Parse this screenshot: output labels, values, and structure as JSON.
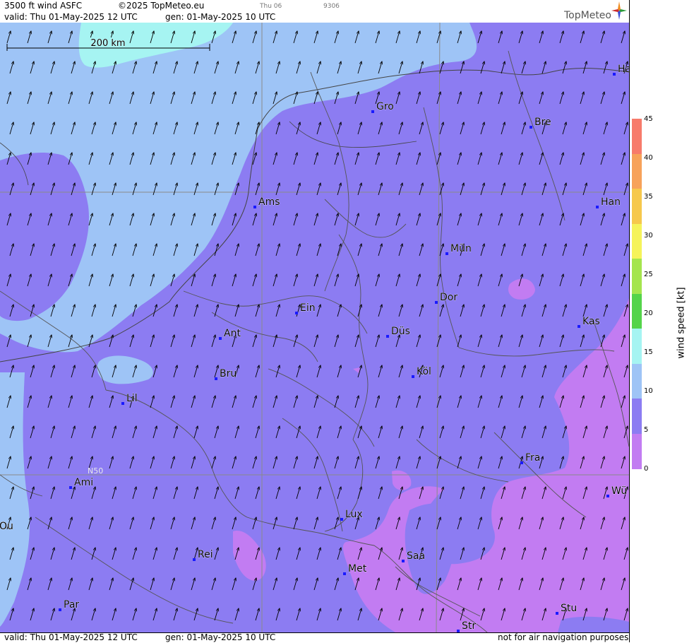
{
  "header": {
    "title": "3500 ft wind ASFC",
    "copyright": "©2025 TopMeteo.eu",
    "valid": "valid:  Thu  01-May-2025  12 UTC",
    "generated": "gen: 01-May-2025 10 UTC",
    "faint_day": "Thu 06",
    "faint_code": "9306",
    "logo": "TopMeteo"
  },
  "footer": {
    "valid": "valid:  Thu  01-May-2025  12 UTC",
    "generated": "gen: 01-May-2025 10 UTC",
    "disclaimer": "not for air navigation purposes"
  },
  "map": {
    "scale_bar_label": "200 km",
    "latitude_label": "N50",
    "cities": [
      "Gro",
      "Bre",
      "Ha",
      "Ams",
      "Han",
      "Mün",
      "Dor",
      "Ein",
      "Kas",
      "Düs",
      "Ant",
      "Köl",
      "Bru",
      "Lil",
      "Fra",
      "Ami",
      "Wü",
      "Lux",
      "Rei",
      "Saa",
      "Ou",
      "Met",
      "Par",
      "Stu",
      "Str"
    ],
    "wind_direction": "from south-southwest (arrows pointing north-northeast)"
  },
  "legend": {
    "unit_label": "wind speed  [kt]",
    "ticks": [
      "45",
      "40",
      "35",
      "30",
      "25",
      "20",
      "15",
      "10",
      "5",
      "0"
    ],
    "colors": [
      "#f77b6b",
      "#f7a25a",
      "#f6c84c",
      "#f5f35a",
      "#a5e54e",
      "#55d44a",
      "#a6f4f2",
      "#9ec4f6",
      "#8c7cf2",
      "#c27cf2"
    ]
  }
}
